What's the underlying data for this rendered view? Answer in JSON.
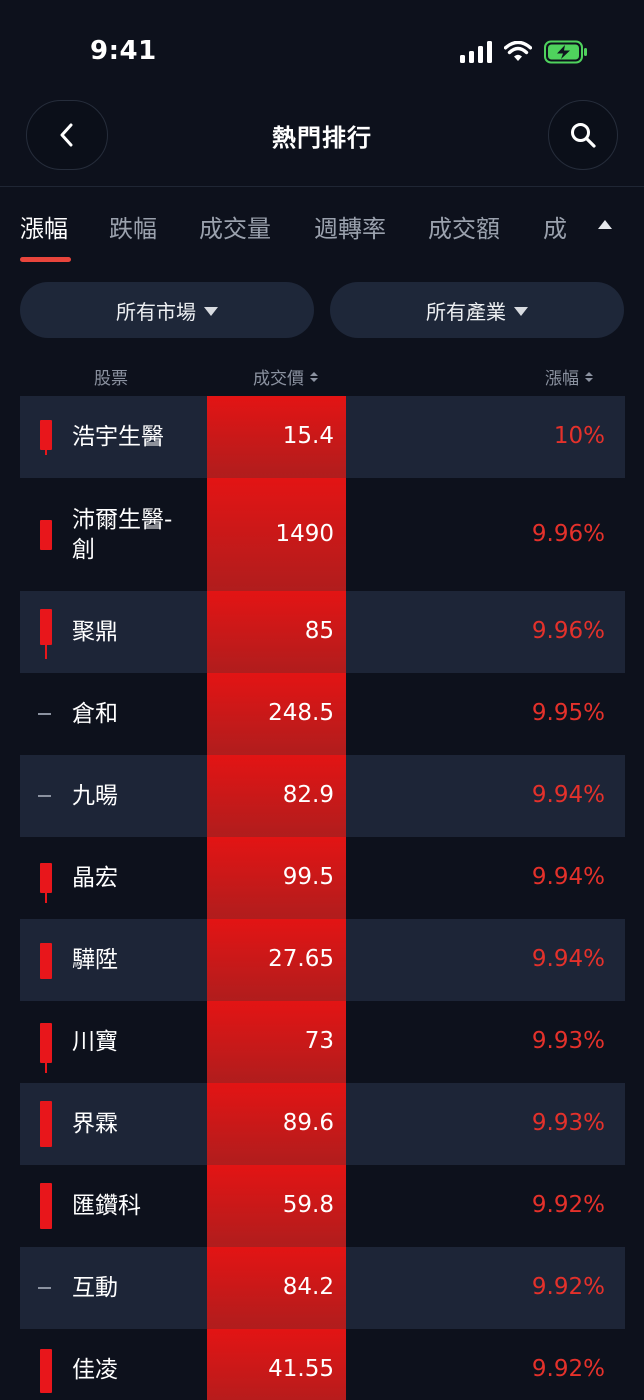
{
  "status_bar": {
    "time": "9:41"
  },
  "nav": {
    "title": "熱門排行"
  },
  "tabs": [
    "漲幅",
    "跌幅",
    "成交量",
    "週轉率",
    "成交額",
    "成"
  ],
  "filters": {
    "market": "所有市場",
    "industry": "所有產業"
  },
  "columns": {
    "stock": "股票",
    "price": "成交價",
    "change": "漲幅"
  },
  "colors": {
    "up": "#e4312b",
    "accent": "#e8453c",
    "background": "#0d111c",
    "row_shaded": "#1d2537",
    "price_cell": "#e31414"
  },
  "rows": [
    {
      "name": "浩宇生醫",
      "price": "15.4",
      "change": "10%",
      "candle": "bar"
    },
    {
      "name": "沛爾生醫-\n創",
      "price": "1490",
      "change": "9.96%",
      "candle": "bar"
    },
    {
      "name": "聚鼎",
      "price": "85",
      "change": "9.96%",
      "candle": "bar"
    },
    {
      "name": "倉和",
      "price": "248.5",
      "change": "9.95%",
      "candle": "flat"
    },
    {
      "name": "九暘",
      "price": "82.9",
      "change": "9.94%",
      "candle": "flat"
    },
    {
      "name": "晶宏",
      "price": "99.5",
      "change": "9.94%",
      "candle": "bar"
    },
    {
      "name": "驊陞",
      "price": "27.65",
      "change": "9.94%",
      "candle": "bar"
    },
    {
      "name": "川寶",
      "price": "73",
      "change": "9.93%",
      "candle": "bar"
    },
    {
      "name": "界霖",
      "price": "89.6",
      "change": "9.93%",
      "candle": "bar"
    },
    {
      "name": "匯鑽科",
      "price": "59.8",
      "change": "9.92%",
      "candle": "bar"
    },
    {
      "name": "互動",
      "price": "84.2",
      "change": "9.92%",
      "candle": "flat"
    },
    {
      "name": "佳凌",
      "price": "41.55",
      "change": "9.92%",
      "candle": "bar"
    }
  ]
}
